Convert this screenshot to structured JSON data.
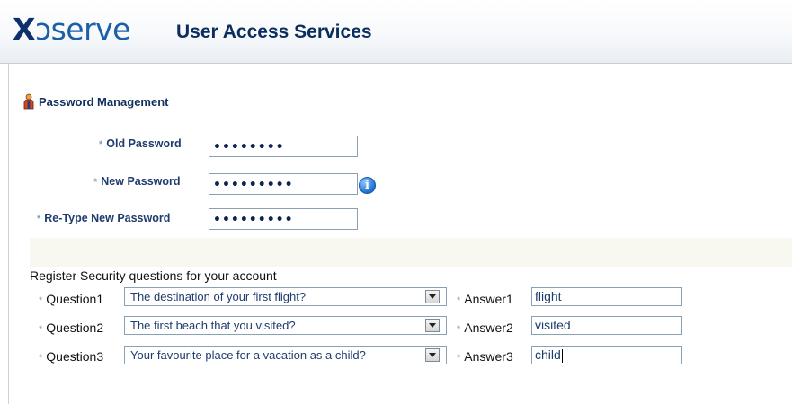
{
  "header": {
    "logo": {
      "part1": "X",
      "part2": "ↄserve"
    },
    "title": "User Access Services"
  },
  "section": {
    "title": "Password Management",
    "icon": "person-icon"
  },
  "password": {
    "old_label": "Old Password",
    "new_label": "New Password",
    "retype_label": "Re-Type New Password",
    "old_value": "••••••••",
    "new_value": "•••••••••",
    "retype_value": "•••••••••",
    "required_marker": "*",
    "info_icon": "info-icon"
  },
  "security": {
    "title": "Register Security questions for your account",
    "rows": [
      {
        "q_label": "Question1",
        "question": "The destination of your first flight?",
        "a_label": "Answer1",
        "answer": "flight"
      },
      {
        "q_label": "Question2",
        "question": "The first beach that you visited?",
        "a_label": "Answer2",
        "answer": "visited"
      },
      {
        "q_label": "Question3",
        "question": "Your favourite place for a vacation as a child?",
        "a_label": "Answer3",
        "answer": "child"
      }
    ]
  },
  "colors": {
    "brand_dark": "#0d2f6b",
    "brand_blue": "#1a5fa8",
    "label_blue": "#1e3c6c",
    "band": "#f8f8f0"
  }
}
